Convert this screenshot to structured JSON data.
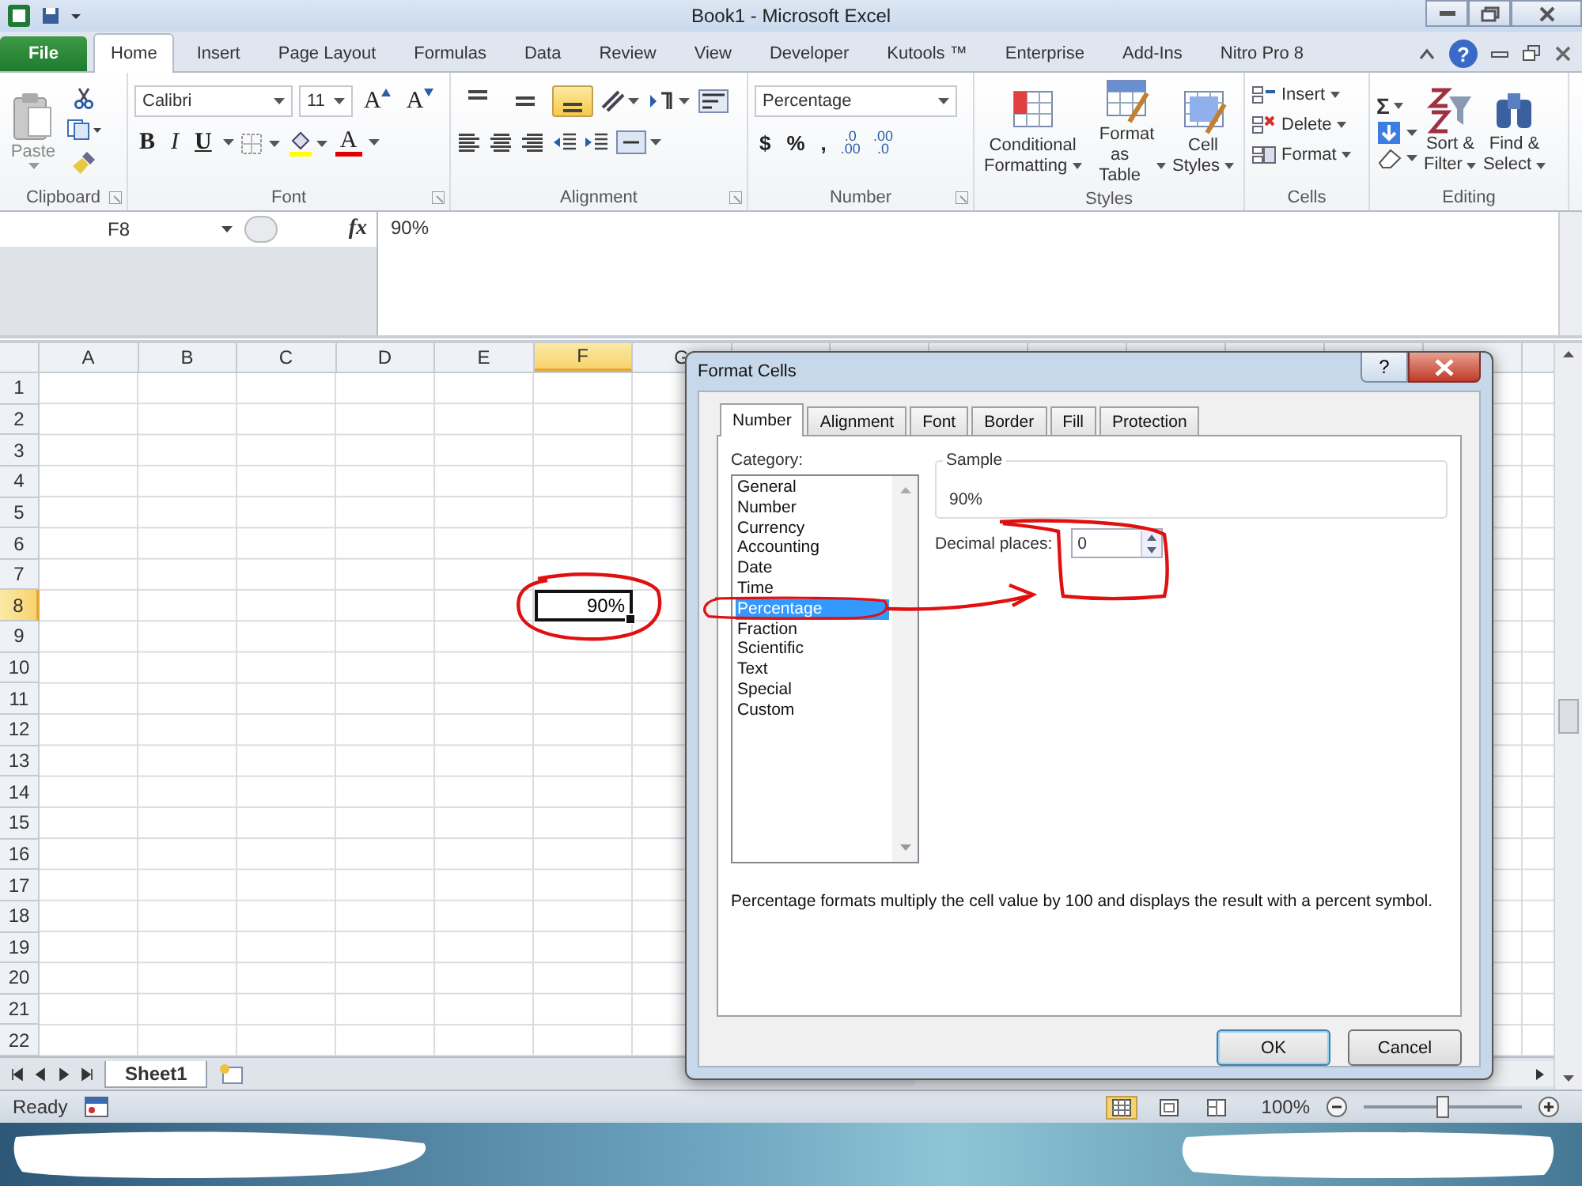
{
  "window": {
    "title": "Book1  -  Microsoft Excel"
  },
  "ribbon_tabs": [
    {
      "label": "File",
      "kind": "file",
      "selected": false
    },
    {
      "label": "Home",
      "kind": "tab",
      "selected": true
    },
    {
      "label": "Insert",
      "kind": "tab",
      "selected": false
    },
    {
      "label": "Page Layout",
      "kind": "tab",
      "selected": false
    },
    {
      "label": "Formulas",
      "kind": "tab",
      "selected": false
    },
    {
      "label": "Data",
      "kind": "tab",
      "selected": false
    },
    {
      "label": "Review",
      "kind": "tab",
      "selected": false
    },
    {
      "label": "View",
      "kind": "tab",
      "selected": false
    },
    {
      "label": "Developer",
      "kind": "tab",
      "selected": false
    },
    {
      "label": "Kutools ™",
      "kind": "tab",
      "selected": false
    },
    {
      "label": "Enterprise",
      "kind": "tab",
      "selected": false
    },
    {
      "label": "Add-Ins",
      "kind": "tab",
      "selected": false
    },
    {
      "label": "Nitro Pro 8",
      "kind": "tab",
      "selected": false
    }
  ],
  "help_button": "?",
  "clipboard": {
    "paste": "Paste",
    "group": "Clipboard"
  },
  "font": {
    "name": "Calibri",
    "size": "11",
    "grow": "A",
    "shrink": "A",
    "bold": "B",
    "italic": "I",
    "underline": "U",
    "font_color_letter": "A",
    "group": "Font"
  },
  "alignment": {
    "vertical": [
      {
        "selected": false
      },
      {
        "selected": false
      },
      {
        "selected": true
      }
    ],
    "group": "Alignment"
  },
  "number": {
    "format": "Percentage",
    "symbols": [
      "$",
      "%",
      ","
    ],
    "decimals": [
      {
        "top": ".0",
        "bottom": ".00"
      },
      {
        "top": ".00",
        "bottom": ".0"
      }
    ],
    "group": "Number"
  },
  "styles": {
    "buttons": [
      {
        "line1": "Conditional",
        "line2": "Formatting"
      },
      {
        "line1": "Format",
        "line2": "as Table"
      },
      {
        "line1": "Cell",
        "line2": "Styles"
      }
    ],
    "group": "Styles"
  },
  "cells": {
    "buttons": [
      "Insert",
      "Delete",
      "Format"
    ],
    "group": "Cells"
  },
  "editing": {
    "sum": "Σ",
    "buttons": [
      {
        "line1": "Sort &",
        "line2": "Filter"
      },
      {
        "line1": "Find &",
        "line2": "Select"
      }
    ],
    "group": "Editing"
  },
  "formula_bar": {
    "name_box": "F8",
    "fx": "fx",
    "formula": "90%"
  },
  "sheet": {
    "columns": [
      {
        "label": "A",
        "selected": false
      },
      {
        "label": "B",
        "selected": false
      },
      {
        "label": "C",
        "selected": false
      },
      {
        "label": "D",
        "selected": false
      },
      {
        "label": "E",
        "selected": false
      },
      {
        "label": "F",
        "selected": true
      },
      {
        "label": "G",
        "selected": false
      }
    ],
    "rows": [
      {
        "label": "1",
        "selected": false
      },
      {
        "label": "2",
        "selected": false
      },
      {
        "label": "3",
        "selected": false
      },
      {
        "label": "4",
        "selected": false
      },
      {
        "label": "5",
        "selected": false
      },
      {
        "label": "6",
        "selected": false
      },
      {
        "label": "7",
        "selected": false
      },
      {
        "label": "8",
        "selected": true
      },
      {
        "label": "9",
        "selected": false
      },
      {
        "label": "10",
        "selected": false
      },
      {
        "label": "11",
        "selected": false
      },
      {
        "label": "12",
        "selected": false
      },
      {
        "label": "13",
        "selected": false
      },
      {
        "label": "14",
        "selected": false
      },
      {
        "label": "15",
        "selected": false
      },
      {
        "label": "16",
        "selected": false
      },
      {
        "label": "17",
        "selected": false
      },
      {
        "label": "18",
        "selected": false
      },
      {
        "label": "19",
        "selected": false
      },
      {
        "label": "20",
        "selected": false
      },
      {
        "label": "21",
        "selected": false
      },
      {
        "label": "22",
        "selected": false
      }
    ],
    "active_cell": {
      "value": "90%"
    }
  },
  "sheet_tabs": [
    {
      "label": "Sheet1",
      "selected": true
    }
  ],
  "status_bar": {
    "status": "Ready",
    "views": [
      {
        "selected": true
      },
      {
        "selected": false
      },
      {
        "selected": false
      }
    ],
    "zoom": "100%",
    "zoom_slider": {
      "level": 0.5
    }
  },
  "dialog": {
    "title": "Format Cells",
    "help": "?",
    "tabs": [
      {
        "label": "Number",
        "selected": true
      },
      {
        "label": "Alignment",
        "selected": false
      },
      {
        "label": "Font",
        "selected": false
      },
      {
        "label": "Border",
        "selected": false
      },
      {
        "label": "Fill",
        "selected": false
      },
      {
        "label": "Protection",
        "selected": false
      }
    ],
    "category_label": "Category:",
    "categories": [
      {
        "label": "General",
        "selected": false
      },
      {
        "label": "Number",
        "selected": false
      },
      {
        "label": "Currency",
        "selected": false
      },
      {
        "label": "Accounting",
        "selected": false
      },
      {
        "label": "Date",
        "selected": false
      },
      {
        "label": "Time",
        "selected": false
      },
      {
        "label": "Percentage",
        "selected": true
      },
      {
        "label": "Fraction",
        "selected": false
      },
      {
        "label": "Scientific",
        "selected": false
      },
      {
        "label": "Text",
        "selected": false
      },
      {
        "label": "Special",
        "selected": false
      },
      {
        "label": "Custom",
        "selected": false
      }
    ],
    "sample": {
      "legend": "Sample",
      "value": "90%"
    },
    "decimal_places": {
      "label": "Decimal places:",
      "value": "0"
    },
    "description": "Percentage formats multiply the cell value by 100 and displays the result with a percent symbol.",
    "buttons": [
      {
        "label": "OK",
        "kind": "default"
      },
      {
        "label": "Cancel",
        "kind": "normal"
      }
    ]
  }
}
